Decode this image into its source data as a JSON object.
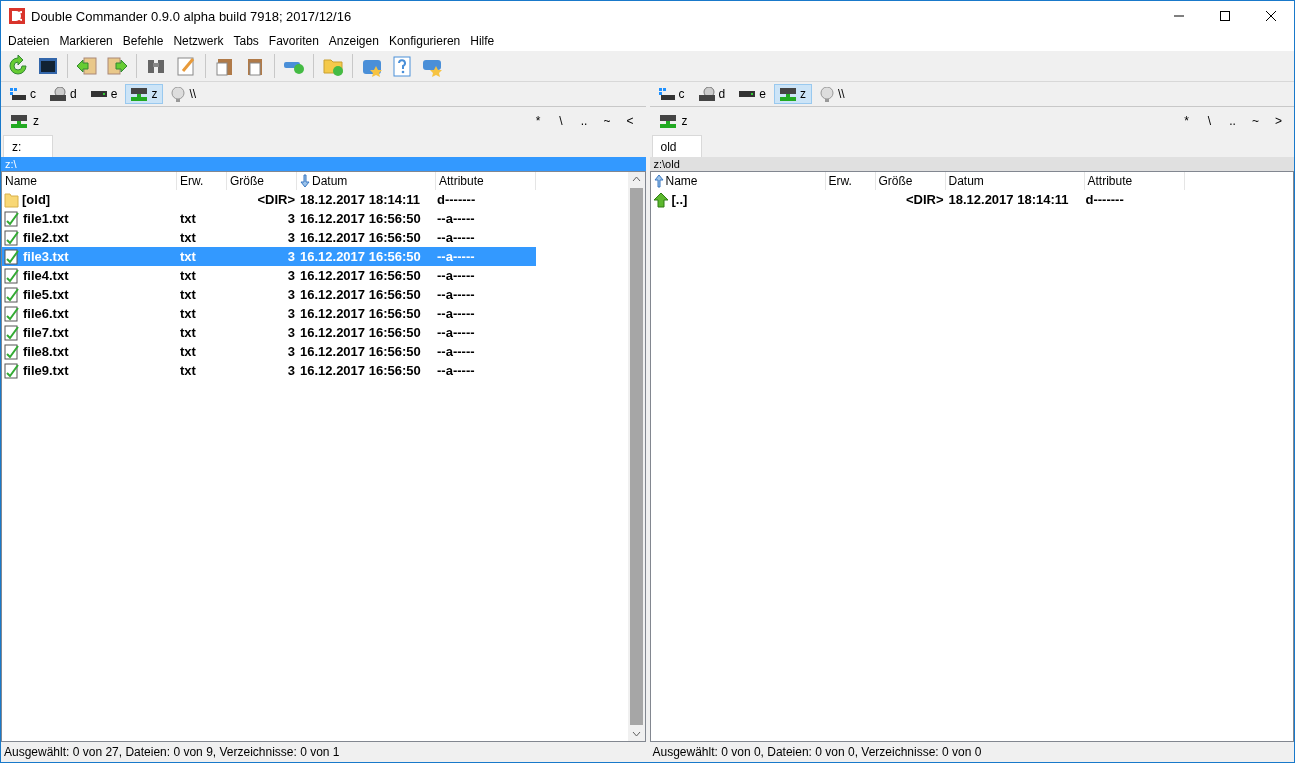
{
  "window": {
    "title": "Double Commander 0.9.0 alpha build 7918; 2017/12/16"
  },
  "menu": [
    "Dateien",
    "Markieren",
    "Befehle",
    "Netzwerk",
    "Tabs",
    "Favoriten",
    "Anzeigen",
    "Konfigurieren",
    "Hilfe"
  ],
  "panels": [
    {
      "active": true,
      "drives": [
        {
          "kind": "system",
          "label": "c",
          "selected": false
        },
        {
          "kind": "optical",
          "label": "d",
          "selected": false
        },
        {
          "kind": "disk",
          "label": "e",
          "selected": false
        },
        {
          "kind": "network",
          "label": "z",
          "selected": true
        },
        {
          "kind": "globe",
          "label": "\\\\",
          "selected": false
        }
      ],
      "drive": "z",
      "nav": [
        "*",
        "\\",
        "..",
        "~",
        "<"
      ],
      "tabs": [
        {
          "label": "z:",
          "selected": true
        }
      ],
      "path": "z:\\",
      "columns": [
        {
          "label": "Name",
          "sorted": false
        },
        {
          "label": "Erw.",
          "sorted": false
        },
        {
          "label": "Größe",
          "sorted": false
        },
        {
          "label": "Datum",
          "sorted": true,
          "ascending": false
        },
        {
          "label": "Attribute",
          "sorted": false
        }
      ],
      "rows": [
        {
          "kind": "folder",
          "name": "[old]",
          "size": "<DIR>",
          "date": "18.12.2017 18:14:11",
          "attr": "d-------",
          "selected": false
        },
        {
          "kind": "file",
          "name": "file1.txt",
          "ext": "txt",
          "size": "3",
          "date": "16.12.2017 16:56:50",
          "attr": "--a-----",
          "selected": false
        },
        {
          "kind": "file",
          "name": "file2.txt",
          "ext": "txt",
          "size": "3",
          "date": "16.12.2017 16:56:50",
          "attr": "--a-----",
          "selected": false
        },
        {
          "kind": "file",
          "name": "file3.txt",
          "ext": "txt",
          "size": "3",
          "date": "16.12.2017 16:56:50",
          "attr": "--a-----",
          "selected": true
        },
        {
          "kind": "file",
          "name": "file4.txt",
          "ext": "txt",
          "size": "3",
          "date": "16.12.2017 16:56:50",
          "attr": "--a-----",
          "selected": false
        },
        {
          "kind": "file",
          "name": "file5.txt",
          "ext": "txt",
          "size": "3",
          "date": "16.12.2017 16:56:50",
          "attr": "--a-----",
          "selected": false
        },
        {
          "kind": "file",
          "name": "file6.txt",
          "ext": "txt",
          "size": "3",
          "date": "16.12.2017 16:56:50",
          "attr": "--a-----",
          "selected": false
        },
        {
          "kind": "file",
          "name": "file7.txt",
          "ext": "txt",
          "size": "3",
          "date": "16.12.2017 16:56:50",
          "attr": "--a-----",
          "selected": false
        },
        {
          "kind": "file",
          "name": "file8.txt",
          "ext": "txt",
          "size": "3",
          "date": "16.12.2017 16:56:50",
          "attr": "--a-----",
          "selected": false
        },
        {
          "kind": "file",
          "name": "file9.txt",
          "ext": "txt",
          "size": "3",
          "date": "16.12.2017 16:56:50",
          "attr": "--a-----",
          "selected": false
        }
      ],
      "status": "Ausgewählt: 0 von 27, Dateien: 0 von 9, Verzeichnisse: 0 von 1"
    },
    {
      "active": false,
      "drives": [
        {
          "kind": "system",
          "label": "c",
          "selected": false
        },
        {
          "kind": "optical",
          "label": "d",
          "selected": false
        },
        {
          "kind": "disk",
          "label": "e",
          "selected": false
        },
        {
          "kind": "network",
          "label": "z",
          "selected": true
        },
        {
          "kind": "globe",
          "label": "\\\\",
          "selected": false
        }
      ],
      "drive": "z",
      "nav": [
        "*",
        "\\",
        "..",
        "~",
        ">"
      ],
      "tabs": [
        {
          "label": "old",
          "selected": true
        }
      ],
      "path": "z:\\old",
      "columns": [
        {
          "label": "Name",
          "sorted": true,
          "ascending": true
        },
        {
          "label": "Erw.",
          "sorted": false
        },
        {
          "label": "Größe",
          "sorted": false
        },
        {
          "label": "Datum",
          "sorted": false
        },
        {
          "label": "Attribute",
          "sorted": false
        }
      ],
      "rows": [
        {
          "kind": "up",
          "name": "[..]",
          "size": "<DIR>",
          "date": "18.12.2017 18:14:11",
          "attr": "d-------",
          "selected": false
        }
      ],
      "status": "Ausgewählt: 0 von 0, Dateien: 0 von 0, Verzeichnisse: 0 von 0"
    }
  ]
}
